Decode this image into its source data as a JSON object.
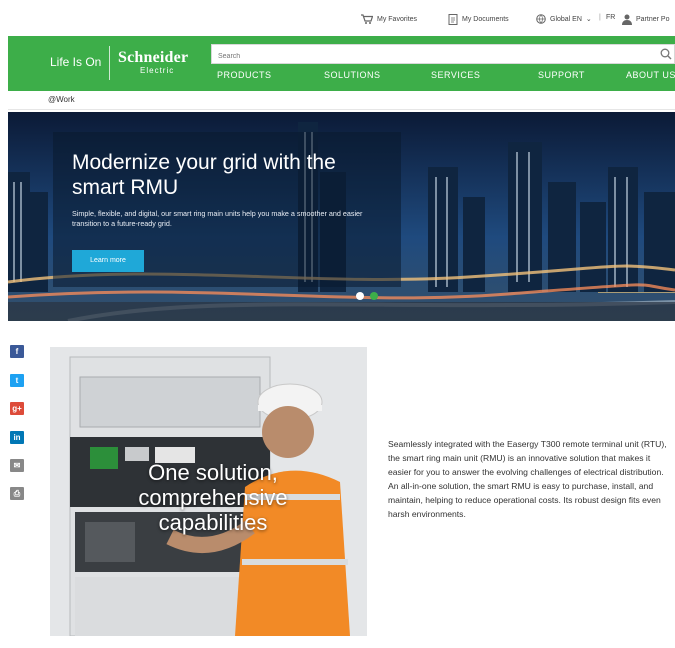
{
  "utility": {
    "favorites": "My Favorites",
    "documents": "My Documents",
    "region": "Global EN",
    "lang": "FR",
    "partner": "Partner Po"
  },
  "header": {
    "tagline": "Life Is On",
    "logo_top": "Schneider",
    "logo_bottom": "Electric",
    "search_placeholder": "Search",
    "nav": [
      "PRODUCTS",
      "SOLUTIONS",
      "SERVICES",
      "SUPPORT",
      "ABOUT US"
    ]
  },
  "breadcrumb": "@Work",
  "hero": {
    "title": "Modernize your grid with the smart RMU",
    "text": "Simple, flexible, and digital, our smart ring main units help you make a smoother and easier transition to a future-ready grid.",
    "button": "Learn more",
    "slides": 2,
    "active_slide": 2
  },
  "social": [
    {
      "icon": "facebook-icon",
      "glyph": "f",
      "color": "#3b5998"
    },
    {
      "icon": "twitter-icon",
      "glyph": "t",
      "color": "#1da1f2"
    },
    {
      "icon": "google-plus-icon",
      "glyph": "g+",
      "color": "#dd4b39"
    },
    {
      "icon": "linkedin-icon",
      "glyph": "in",
      "color": "#0077b5"
    },
    {
      "icon": "email-icon",
      "glyph": "✉",
      "color": "#888888"
    },
    {
      "icon": "print-icon",
      "glyph": "⎙",
      "color": "#888888"
    }
  ],
  "feature": {
    "caption": "One solution, comprehensive capabilities",
    "text": "Seamlessly integrated with the Easergy T300 remote terminal unit (RTU), the smart ring main unit (RMU) is an innovative solution that makes it easier for you to answer the evolving challenges of electrical distribution. An all-in-one solution, the smart RMU is easy to purchase, install, and maintain, helping to reduce operational costs. Its robust design fits even harsh environments."
  },
  "colors": {
    "brand_green": "#3dae49",
    "button_blue": "#1fa8d8"
  }
}
